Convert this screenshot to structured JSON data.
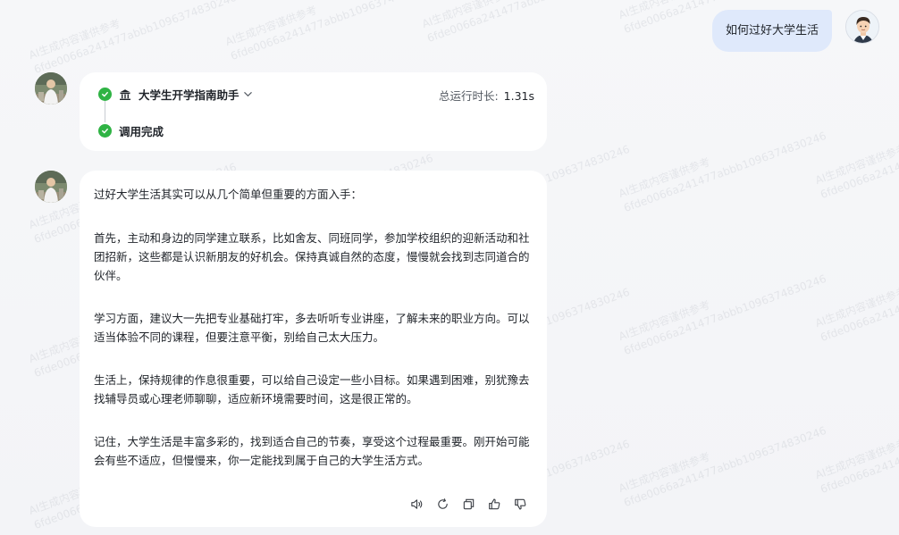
{
  "watermark": {
    "line1": "AI生成内容谨供参考",
    "line2": "6fde0066a241477abbb1096374830246"
  },
  "user_message": {
    "text": "如何过好大学生活"
  },
  "tool_panel": {
    "title": "大学生开学指南助手",
    "runtime_label": "总运行时长:",
    "runtime_value": "1.31s",
    "status_label": "调用完成"
  },
  "answer": {
    "intro": "过好大学生活其实可以从几个简单但重要的方面入手：",
    "paragraphs": [
      "首先，主动和身边的同学建立联系，比如舍友、同班同学，参加学校组织的迎新活动和社团招新，这些都是认识新朋友的好机会。保持真诚自然的态度，慢慢就会找到志同道合的伙伴。",
      "学习方面，建议大一先把专业基础打牢，多去听听专业讲座，了解未来的职业方向。可以适当体验不同的课程，但要注意平衡，别给自己太大压力。",
      "生活上，保持规律的作息很重要，可以给自己设定一些小目标。如果遇到困难，别犹豫去找辅导员或心理老师聊聊，适应新环境需要时间，这是很正常的。",
      "记住，大学生活是丰富多彩的，找到适合自己的节奏，享受这个过程最重要。刚开始可能会有些不适应，但慢慢来，你一定能找到属于自己的大学生活方式。"
    ]
  },
  "action_icons": [
    "speaker-icon",
    "refresh-icon",
    "copy-icon",
    "thumbs-up-icon",
    "thumbs-down-icon"
  ],
  "colors": {
    "user_bubble": "#dfe9fb",
    "check_green": "#2fb344",
    "card_bg": "#ffffff",
    "page_bg": "#f4f5f8"
  }
}
